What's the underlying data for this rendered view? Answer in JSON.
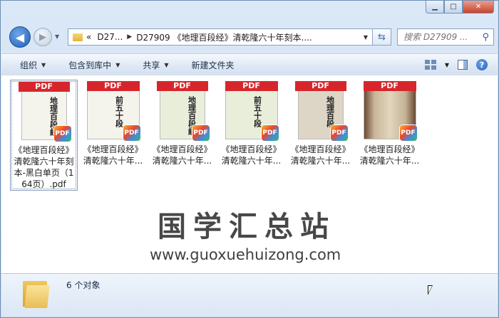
{
  "window": {
    "minimize_label": "▁",
    "maximize_label": "□",
    "close_label": "✕"
  },
  "nav": {
    "back_label": "◀",
    "forward_label": "▶",
    "overflow": "«",
    "crumbs": [
      "D27...",
      "D27909 《地理百段经》清乾隆六十年刻本...."
    ],
    "search_placeholder": "搜索 D27909 ..."
  },
  "toolbar": {
    "organize": "组织",
    "include_library": "包含到库中",
    "share": "共享",
    "new_folder": "新建文件夹"
  },
  "files": [
    {
      "name": "《地理百段经》清乾隆六十年刻本-黑白单页（164页）.pdf",
      "badge": "PDF",
      "page_text": "地理百段經",
      "selected": true
    },
    {
      "name": "《地理百段经》清乾隆六十年...",
      "badge": "PDF",
      "page_text": "前五十段",
      "selected": false
    },
    {
      "name": "《地理百段经》清乾隆六十年...",
      "badge": "PDF",
      "page_text": "地理百段經",
      "selected": false
    },
    {
      "name": "《地理百段经》清乾隆六十年...",
      "badge": "PDF",
      "page_text": "前五十段",
      "selected": false
    },
    {
      "name": "《地理百段经》清乾隆六十年...",
      "badge": "PDF",
      "page_text": "地理百段",
      "selected": false
    },
    {
      "name": "《地理百段经》清乾隆六十年...",
      "badge": "PDF",
      "page_text": "",
      "selected": false
    }
  ],
  "pdf_mark": "PDF",
  "watermark": {
    "title": "国学汇总站",
    "url": "www.guoxuehuizong.com"
  },
  "status": {
    "count_text": "6 个对象"
  },
  "colors": {
    "pdf_badge": "#d6262c",
    "accent": "#1f5fb7"
  }
}
